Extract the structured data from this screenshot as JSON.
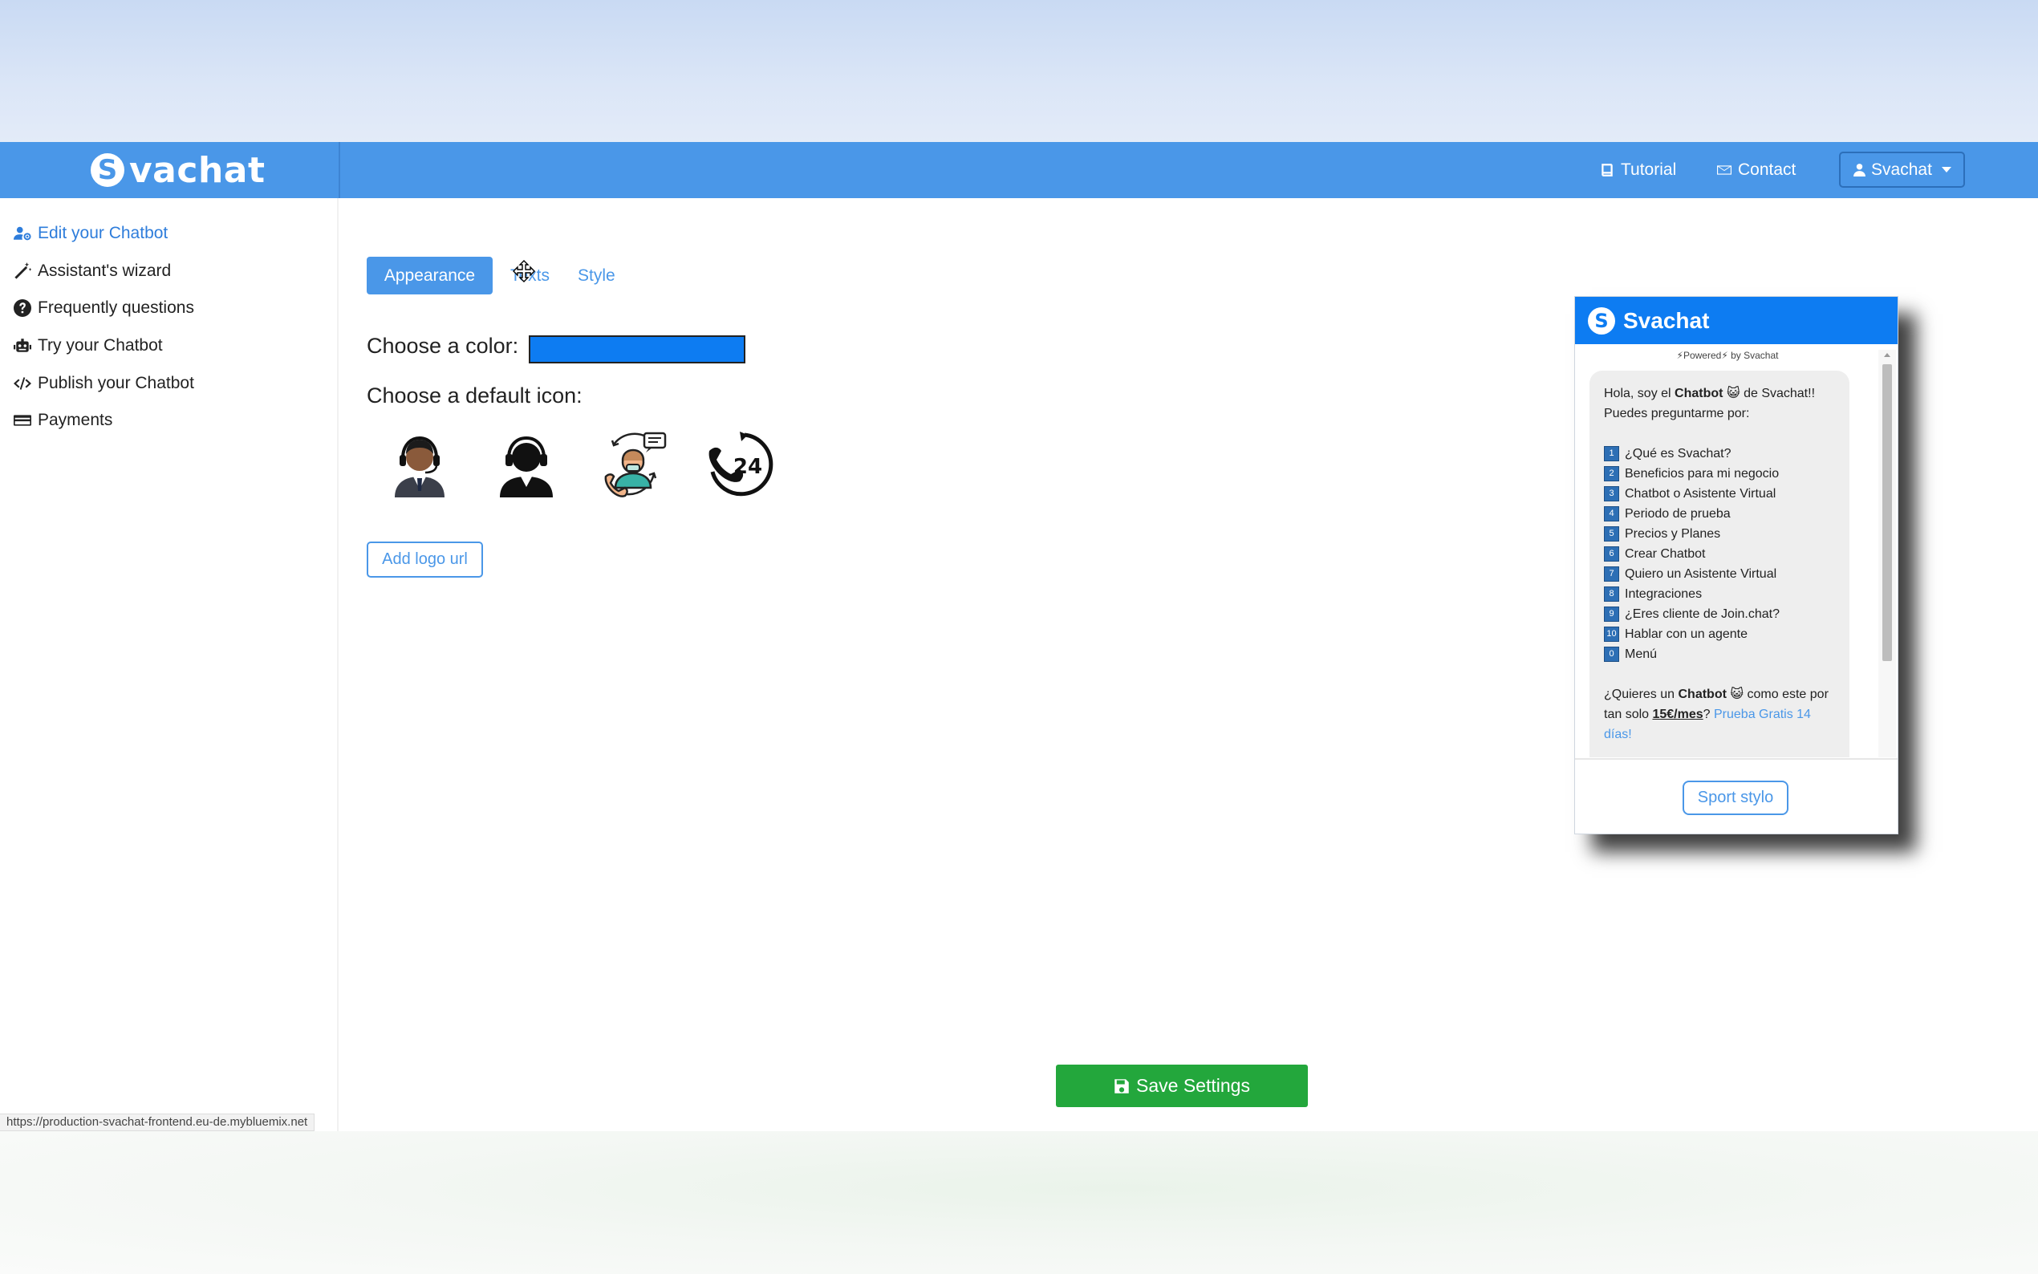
{
  "navbar": {
    "brand_initial": "S",
    "brand_text": "vachat",
    "tutorial_label": "Tutorial",
    "contact_label": "Contact",
    "user_label": "Svachat"
  },
  "sidebar": {
    "items": [
      {
        "label": "Edit your Chatbot",
        "icon": "user-gear-icon",
        "active": true
      },
      {
        "label": "Assistant's wizard",
        "icon": "magic-wand-icon"
      },
      {
        "label": "Frequently questions",
        "icon": "question-circle-icon"
      },
      {
        "label": "Try your Chatbot",
        "icon": "robot-icon"
      },
      {
        "label": "Publish your Chatbot",
        "icon": "code-icon"
      },
      {
        "label": "Payments",
        "icon": "credit-card-icon"
      }
    ],
    "status_url": "https://production-svachat-frontend.eu-de.mybluemix.net"
  },
  "tabs": {
    "appearance": "Appearance",
    "texts": "Texts",
    "style": "Style"
  },
  "appearance": {
    "color_label": "Choose a color:",
    "selected_color": "#0d7cf2",
    "icon_label": "Choose a default icon:",
    "icons": [
      "agent-headset-dark-icon",
      "agent-headset-black-icon",
      "support-agent-phone-icon",
      "phone-24h-icon"
    ],
    "add_logo_label": "Add logo url",
    "save_label": "Save Settings"
  },
  "chat_preview": {
    "logo_initial": "S",
    "title": "Svachat",
    "powered": "⚡Powered⚡ by Svachat",
    "greeting_pre": "Hola, soy el ",
    "greeting_bold": "Chatbot",
    "greeting_emoji": "😺",
    "greeting_post": " de Svachat!! Puedes preguntarme por:",
    "options": [
      {
        "num": "1",
        "text": "¿Qué es Svachat?"
      },
      {
        "num": "2",
        "text": "Beneficios para mi negocio"
      },
      {
        "num": "3",
        "text": "Chatbot o Asistente Virtual"
      },
      {
        "num": "4",
        "text": "Periodo de prueba"
      },
      {
        "num": "5",
        "text": "Precios y Planes"
      },
      {
        "num": "6",
        "text": "Crear Chatbot"
      },
      {
        "num": "7",
        "text": "Quiero un Asistente Virtual"
      },
      {
        "num": "8",
        "text": "Integraciones"
      },
      {
        "num": "9",
        "text": "¿Eres cliente de Join.chat?"
      },
      {
        "num": "10",
        "text": "Hablar con un agente"
      },
      {
        "num": "0",
        "text": "Menú"
      }
    ],
    "promo_pre": "¿Quieres un ",
    "promo_bold": "Chatbot",
    "promo_emoji": "😺",
    "promo_mid": " como este por tan solo ",
    "promo_price": "15€/mes",
    "promo_q": "? ",
    "promo_link": "Prueba Gratis 14 días!",
    "footer_button": "Sport stylo"
  },
  "colors": {
    "navbar": "#4a97e8",
    "accent": "#0d7cf2",
    "save": "#23a73c"
  }
}
